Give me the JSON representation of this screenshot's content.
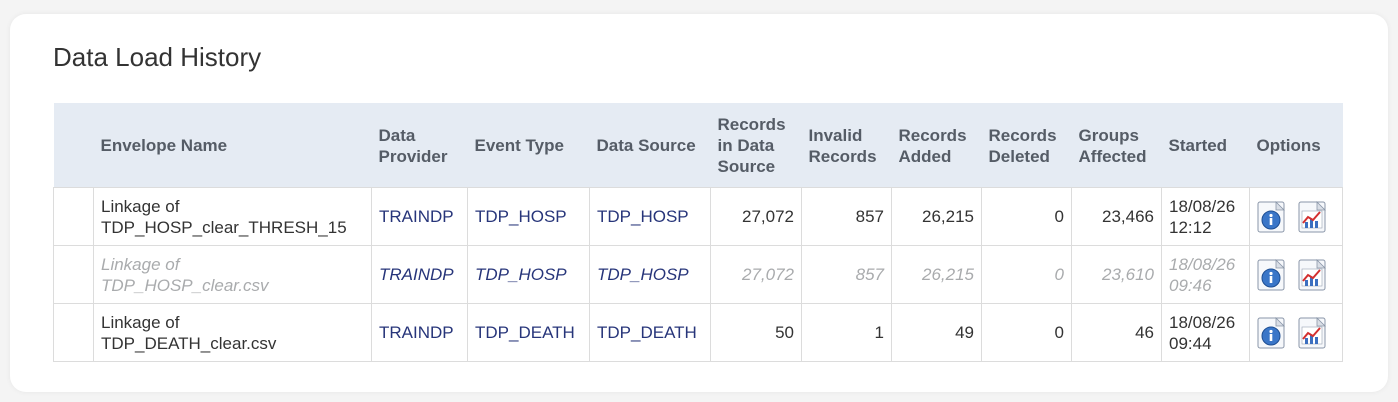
{
  "page": {
    "title": "Data Load History"
  },
  "table": {
    "headers": {
      "envelope_name": "Envelope Name",
      "data_provider": [
        "Data",
        "Provider"
      ],
      "event_type": "Event Type",
      "data_source": "Data Source",
      "records_in_source": [
        "Records",
        "in Data",
        "Source"
      ],
      "invalid_records": [
        "Invalid",
        "Records"
      ],
      "records_added": [
        "Records",
        "Added"
      ],
      "records_deleted": [
        "Records",
        "Deleted"
      ],
      "groups_affected": [
        "Groups",
        "Affected"
      ],
      "started": "Started",
      "options": "Options"
    },
    "rows": [
      {
        "envelope_name": [
          "Linkage of",
          "TDP_HOSP_clear_THRESH_15"
        ],
        "data_provider": "TRAINDP",
        "event_type": "TDP_HOSP",
        "data_source": "TDP_HOSP",
        "records_in_source": "27,072",
        "invalid_records": "857",
        "records_added": "26,215",
        "records_deleted": "0",
        "groups_affected": "23,466",
        "started": [
          "18/08/26",
          "12:12"
        ],
        "muted": false
      },
      {
        "envelope_name": [
          "Linkage of",
          "TDP_HOSP_clear.csv"
        ],
        "data_provider": "TRAINDP",
        "event_type": "TDP_HOSP",
        "data_source": "TDP_HOSP",
        "records_in_source": "27,072",
        "invalid_records": "857",
        "records_added": "26,215",
        "records_deleted": "0",
        "groups_affected": "23,610",
        "started": [
          "18/08/26",
          "09:46"
        ],
        "muted": true
      },
      {
        "envelope_name": [
          "Linkage of",
          "TDP_DEATH_clear.csv"
        ],
        "data_provider": "TRAINDP",
        "event_type": "TDP_DEATH",
        "data_source": "TDP_DEATH",
        "records_in_source": "50",
        "invalid_records": "1",
        "records_added": "49",
        "records_deleted": "0",
        "groups_affected": "46",
        "started": [
          "18/08/26",
          "09:44"
        ],
        "muted": false
      }
    ],
    "option_icons": [
      "info-icon",
      "chart-icon"
    ]
  },
  "colors": {
    "header_bg": "#e5ebf3",
    "link": "#27357a",
    "muted_text": "#a9abad"
  }
}
